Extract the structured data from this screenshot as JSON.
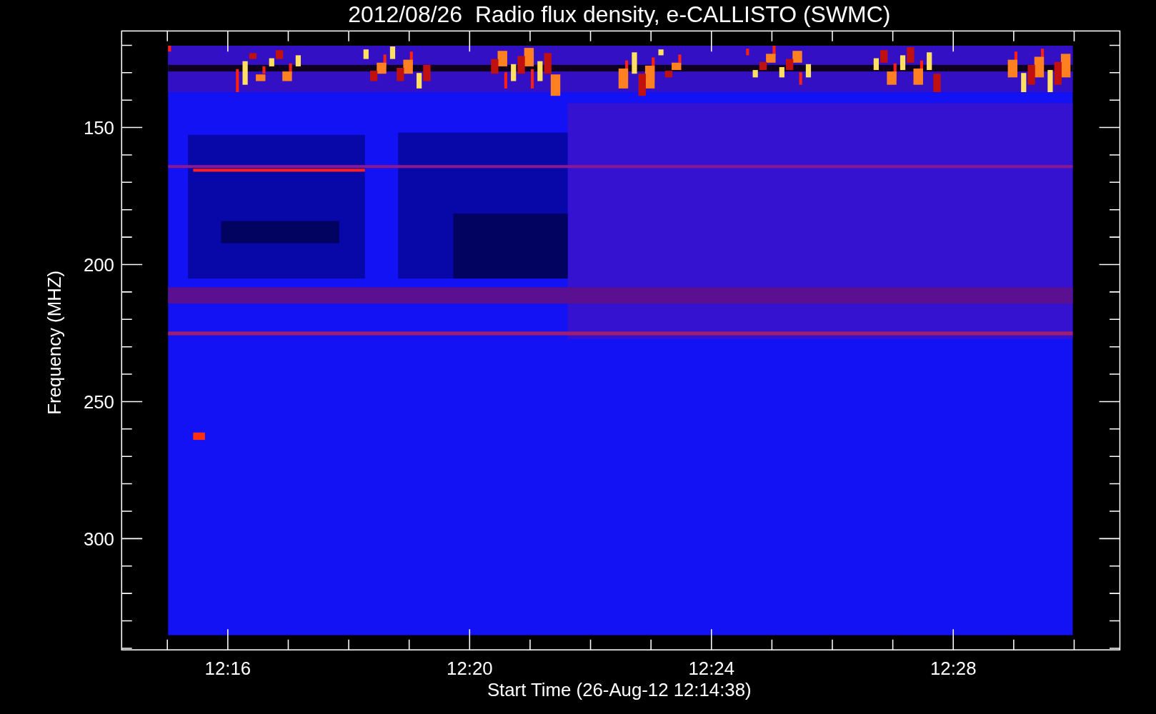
{
  "title": "2012/08/26  Radio flux density, e-CALLISTO (SWMC)",
  "y_axis": {
    "label": "Frequency (MHZ)",
    "ticks": [
      "150",
      "200",
      "250",
      "300"
    ]
  },
  "x_axis": {
    "label": "Start Time (26-Aug-12 12:14:38)",
    "ticks": [
      "12:16",
      "12:20",
      "12:24",
      "12:28"
    ]
  }
}
